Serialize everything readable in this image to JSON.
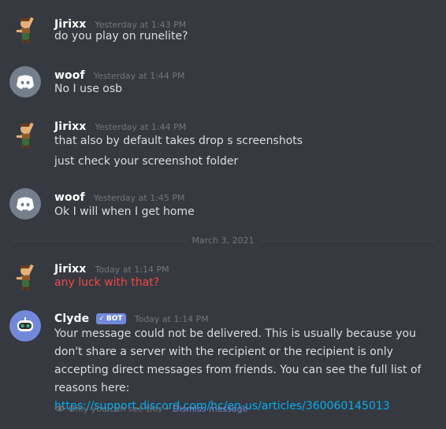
{
  "messages": [
    {
      "author": "Jirixx",
      "timestamp": "Yesterday at 1:43 PM",
      "lines": [
        "do you play on runelite?"
      ]
    },
    {
      "author": "woof",
      "timestamp": "Yesterday at 1:44 PM",
      "lines": [
        "No I use osb"
      ]
    },
    {
      "author": "Jirixx",
      "timestamp": "Yesterday at 1:44 PM",
      "lines": [
        "that also by default takes drop s screenshots",
        "just check your screenshot folder"
      ]
    },
    {
      "author": "woof",
      "timestamp": "Yesterday at 1:45 PM",
      "lines": [
        "Ok I will when I get home"
      ]
    },
    {
      "author": "Jirixx",
      "timestamp": "Today at 1:14 PM",
      "lines": [
        "any luck with that?"
      ],
      "failed": true
    },
    {
      "author": "Clyde",
      "bot_tag": "BOT",
      "bot_check": "✓",
      "timestamp": "Today at 1:14 PM",
      "body": "Your message could not be delivered. This is usually because you don't share a server with the recipient or the recipient is only accepting direct messages from friends. You can see the full list of reasons here:",
      "link": "https://support.discord.com/hc/en-us/articles/360060145013",
      "ephemeral_note": "Only you can see this",
      "separator": "•",
      "dismiss_label": "Dismiss message"
    }
  ],
  "date_divider": "March 3, 2021",
  "colors": {
    "background": "#36393f",
    "failed_text": "#f04747",
    "link": "#00b0f4",
    "blurple": "#7289da",
    "discord_gray_avatar": "#747f8d"
  },
  "icons": {
    "jirixx_avatar": "waving-character-avatar",
    "woof_avatar": "discord-default-avatar",
    "clyde_avatar": "clyde-bot-avatar",
    "eye": "eye-icon"
  }
}
